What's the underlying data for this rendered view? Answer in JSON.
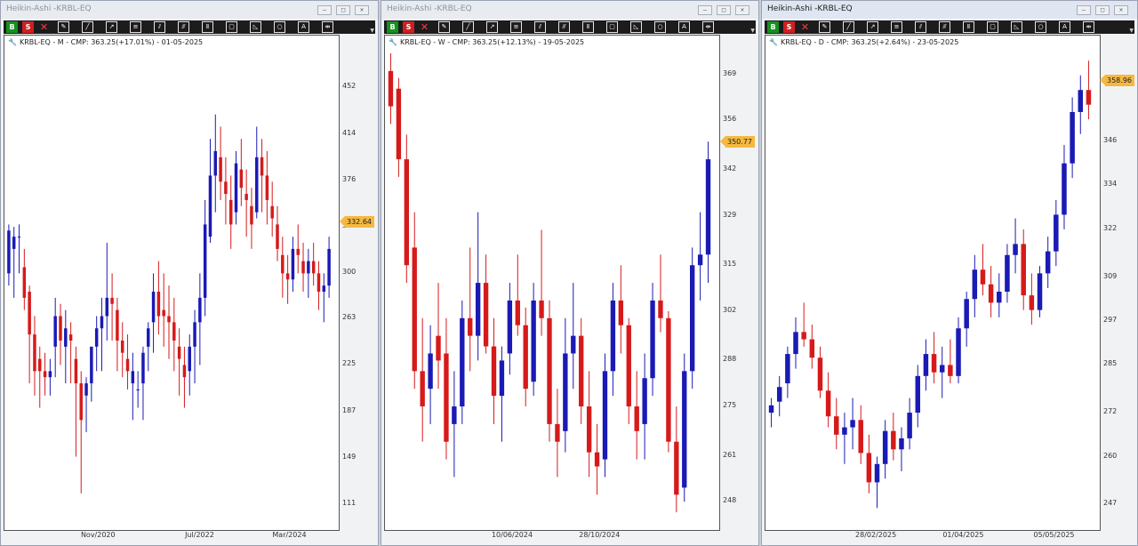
{
  "colors": {
    "bull": "#1a1ab5",
    "bear": "#d61a1a",
    "tag": "#f5b941"
  },
  "windows": [
    {
      "title": "Heikin-Ashi -KRBL-EQ",
      "active": false,
      "chart_title": "KRBL-EQ - M - CMP: 363.25(+17.01%) - 01-05-2025",
      "price_ticks": [
        "452",
        "414",
        "376",
        "338",
        "300",
        "263",
        "225",
        "187",
        "149",
        "111"
      ],
      "date_ticks": [
        "Nov/2020",
        "Jul/2022",
        "Mar/2024"
      ],
      "last_price": "332.64"
    },
    {
      "title": "Heikin-Ashi -KRBL-EQ",
      "active": false,
      "chart_title": "KRBL-EQ - W - CMP: 363.25(+12.13%) - 19-05-2025",
      "price_ticks": [
        "369",
        "356",
        "342",
        "329",
        "315",
        "302",
        "288",
        "275",
        "261",
        "248"
      ],
      "date_ticks": [
        "10/06/2024",
        "28/10/2024"
      ],
      "last_price": "350.77"
    },
    {
      "title": "Heikin-Ashi -KRBL-EQ",
      "active": true,
      "chart_title": "KRBL-EQ - D - CMP: 363.25(+2.64%) - 23-05-2025",
      "price_ticks": [
        "346",
        "334",
        "322",
        "309",
        "297",
        "285",
        "272",
        "260",
        "247"
      ],
      "date_ticks": [
        "28/02/2025",
        "01/04/2025",
        "05/05/2025"
      ],
      "last_price": "358.96"
    }
  ],
  "toolbar": {
    "buy": "B",
    "sell": "S",
    "icons": [
      "close-icon",
      "edit-icon",
      "line-icon",
      "ray-icon",
      "hline-icon",
      "channel-icon",
      "trend-channel-icon",
      "fib-icon",
      "rect-icon",
      "triangle-icon",
      "circle-icon",
      "text-icon",
      "hand-icon"
    ]
  },
  "controls": {
    "min": "—",
    "max": "□",
    "close": "✕"
  },
  "chart_data": [
    {
      "type": "candlestick",
      "series": "KRBL-EQ M",
      "points": [
        [
          300,
          340,
          290,
          335
        ],
        [
          320,
          338,
          280,
          330
        ],
        [
          330,
          340,
          300,
          330
        ],
        [
          305,
          320,
          270,
          280
        ],
        [
          285,
          290,
          210,
          250
        ],
        [
          250,
          265,
          200,
          220
        ],
        [
          230,
          240,
          190,
          220
        ],
        [
          220,
          235,
          200,
          215
        ],
        [
          215,
          230,
          200,
          220
        ],
        [
          240,
          280,
          215,
          265
        ],
        [
          265,
          275,
          225,
          245
        ],
        [
          240,
          270,
          210,
          255
        ],
        [
          250,
          260,
          210,
          245
        ],
        [
          230,
          240,
          150,
          210
        ],
        [
          210,
          220,
          120,
          180
        ],
        [
          200,
          215,
          170,
          210
        ],
        [
          210,
          240,
          195,
          240
        ],
        [
          240,
          265,
          220,
          255
        ],
        [
          255,
          280,
          220,
          265
        ],
        [
          265,
          325,
          245,
          280
        ],
        [
          280,
          300,
          245,
          275
        ],
        [
          270,
          280,
          220,
          245
        ],
        [
          245,
          260,
          215,
          235
        ],
        [
          230,
          250,
          205,
          220
        ],
        [
          210,
          235,
          180,
          220
        ],
        [
          205,
          220,
          190,
          205
        ],
        [
          210,
          240,
          180,
          235
        ],
        [
          240,
          260,
          220,
          255
        ],
        [
          260,
          300,
          235,
          285
        ],
        [
          285,
          310,
          250,
          265
        ],
        [
          270,
          300,
          240,
          265
        ],
        [
          265,
          290,
          230,
          260
        ],
        [
          260,
          280,
          220,
          245
        ],
        [
          240,
          255,
          200,
          230
        ],
        [
          225,
          240,
          190,
          215
        ],
        [
          220,
          250,
          200,
          240
        ],
        [
          240,
          270,
          210,
          260
        ],
        [
          260,
          300,
          225,
          280
        ],
        [
          280,
          360,
          265,
          340
        ],
        [
          330,
          410,
          325,
          380
        ],
        [
          380,
          430,
          350,
          400
        ],
        [
          395,
          420,
          360,
          375
        ],
        [
          375,
          395,
          340,
          365
        ],
        [
          360,
          380,
          320,
          340
        ],
        [
          350,
          400,
          340,
          390
        ],
        [
          385,
          410,
          355,
          370
        ],
        [
          365,
          385,
          330,
          360
        ],
        [
          355,
          370,
          320,
          340
        ],
        [
          350,
          420,
          345,
          395
        ],
        [
          395,
          410,
          350,
          380
        ],
        [
          380,
          400,
          340,
          360
        ],
        [
          355,
          375,
          330,
          345
        ],
        [
          340,
          355,
          310,
          320
        ],
        [
          315,
          330,
          280,
          300
        ],
        [
          300,
          315,
          275,
          295
        ],
        [
          295,
          330,
          285,
          320
        ],
        [
          320,
          340,
          300,
          315
        ],
        [
          310,
          325,
          285,
          300
        ],
        [
          300,
          320,
          280,
          310
        ],
        [
          310,
          325,
          290,
          300
        ],
        [
          300,
          310,
          270,
          285
        ],
        [
          285,
          300,
          260,
          290
        ],
        [
          290,
          330,
          280,
          320
        ]
      ]
    },
    {
      "type": "candlestick",
      "series": "KRBL-EQ W",
      "points": [
        [
          370,
          375,
          355,
          360
        ],
        [
          365,
          368,
          340,
          345
        ],
        [
          345,
          352,
          310,
          315
        ],
        [
          320,
          330,
          280,
          285
        ],
        [
          285,
          300,
          265,
          275
        ],
        [
          280,
          298,
          270,
          290
        ],
        [
          295,
          310,
          280,
          288
        ],
        [
          290,
          300,
          260,
          265
        ],
        [
          270,
          285,
          255,
          275
        ],
        [
          275,
          305,
          270,
          300
        ],
        [
          300,
          320,
          285,
          295
        ],
        [
          295,
          330,
          288,
          310
        ],
        [
          310,
          318,
          290,
          292
        ],
        [
          292,
          300,
          270,
          278
        ],
        [
          278,
          292,
          265,
          288
        ],
        [
          290,
          310,
          284,
          305
        ],
        [
          305,
          318,
          295,
          298
        ],
        [
          298,
          303,
          275,
          280
        ],
        [
          282,
          310,
          278,
          305
        ],
        [
          305,
          325,
          295,
          300
        ],
        [
          300,
          305,
          265,
          270
        ],
        [
          270,
          280,
          255,
          265
        ],
        [
          268,
          300,
          262,
          290
        ],
        [
          290,
          310,
          280,
          295
        ],
        [
          295,
          300,
          270,
          275
        ],
        [
          275,
          285,
          255,
          262
        ],
        [
          262,
          270,
          250,
          258
        ],
        [
          260,
          290,
          255,
          285
        ],
        [
          285,
          310,
          278,
          305
        ],
        [
          305,
          315,
          290,
          298
        ],
        [
          298,
          300,
          270,
          275
        ],
        [
          275,
          285,
          260,
          268
        ],
        [
          270,
          290,
          260,
          283
        ],
        [
          283,
          310,
          278,
          305
        ],
        [
          305,
          318,
          296,
          300
        ],
        [
          300,
          302,
          262,
          265
        ],
        [
          265,
          275,
          245,
          250
        ],
        [
          252,
          290,
          248,
          285
        ],
        [
          285,
          320,
          280,
          315
        ],
        [
          315,
          330,
          305,
          318
        ],
        [
          318,
          350,
          310,
          345
        ]
      ]
    },
    {
      "type": "candlestick",
      "series": "KRBL-EQ D",
      "points": [
        [
          272,
          276,
          268,
          274
        ],
        [
          275,
          282,
          271,
          279
        ],
        [
          280,
          290,
          276,
          288
        ],
        [
          288,
          298,
          284,
          294
        ],
        [
          294,
          302,
          290,
          292
        ],
        [
          292,
          296,
          284,
          287
        ],
        [
          287,
          290,
          276,
          278
        ],
        [
          278,
          283,
          268,
          271
        ],
        [
          271,
          276,
          262,
          266
        ],
        [
          266,
          272,
          258,
          268
        ],
        [
          268,
          276,
          262,
          270
        ],
        [
          270,
          274,
          258,
          261
        ],
        [
          261,
          266,
          250,
          253
        ],
        [
          253,
          260,
          246,
          258
        ],
        [
          258,
          270,
          254,
          267
        ],
        [
          267,
          272,
          259,
          262
        ],
        [
          262,
          268,
          256,
          265
        ],
        [
          265,
          276,
          262,
          272
        ],
        [
          272,
          285,
          268,
          282
        ],
        [
          282,
          292,
          278,
          288
        ],
        [
          288,
          294,
          280,
          283
        ],
        [
          283,
          290,
          276,
          285
        ],
        [
          285,
          292,
          280,
          282
        ],
        [
          282,
          298,
          280,
          295
        ],
        [
          295,
          305,
          290,
          303
        ],
        [
          303,
          315,
          298,
          311
        ],
        [
          311,
          318,
          304,
          307
        ],
        [
          307,
          312,
          298,
          302
        ],
        [
          302,
          310,
          298,
          305
        ],
        [
          305,
          318,
          302,
          315
        ],
        [
          315,
          325,
          310,
          318
        ],
        [
          318,
          322,
          300,
          304
        ],
        [
          304,
          310,
          296,
          300
        ],
        [
          300,
          312,
          298,
          310
        ],
        [
          310,
          320,
          306,
          316
        ],
        [
          316,
          330,
          312,
          326
        ],
        [
          326,
          345,
          322,
          340
        ],
        [
          340,
          358,
          336,
          354
        ],
        [
          354,
          364,
          348,
          360
        ],
        [
          360,
          368,
          352,
          356
        ]
      ]
    }
  ]
}
